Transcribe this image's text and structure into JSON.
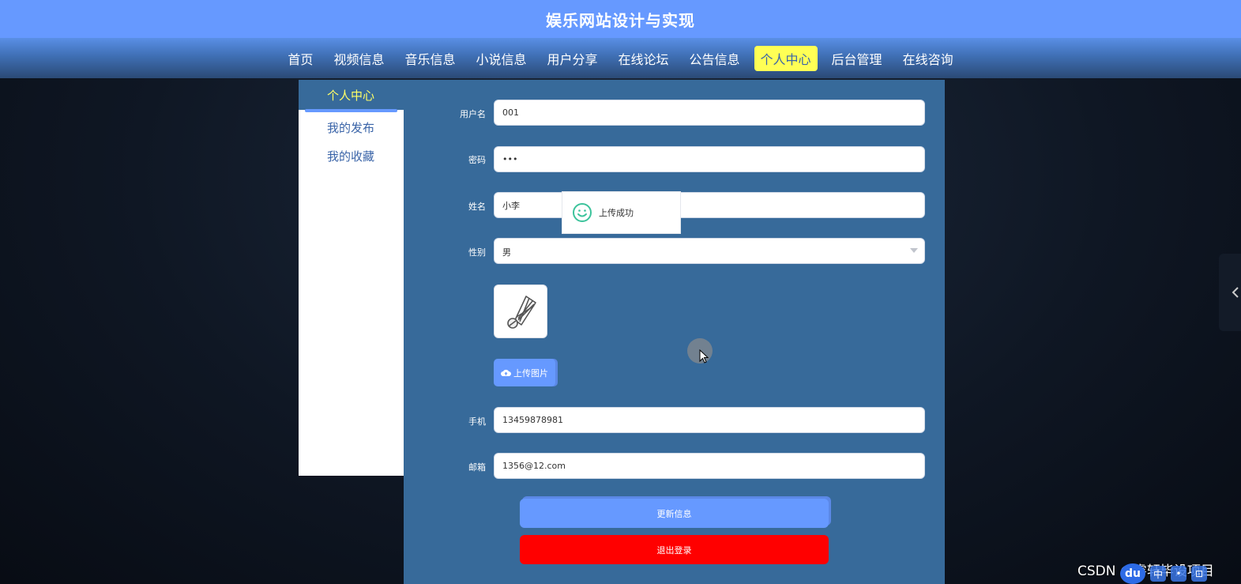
{
  "site_title": "娱乐网站设计与实现",
  "nav": {
    "items": [
      "首页",
      "视频信息",
      "音乐信息",
      "小说信息",
      "用户分享",
      "在线论坛",
      "公告信息",
      "个人中心",
      "后台管理",
      "在线咨询"
    ],
    "active": "个人中心"
  },
  "sidebar": {
    "title": "个人中心",
    "items": [
      "我的发布",
      "我的收藏"
    ]
  },
  "form": {
    "username": {
      "label": "用户名",
      "value": "001"
    },
    "password": {
      "label": "密码",
      "value": "•••"
    },
    "name": {
      "label": "姓名",
      "value": "小李"
    },
    "gender": {
      "label": "性别",
      "value": "男"
    },
    "upload_label": "上传图片",
    "phone": {
      "label": "手机",
      "value": "13459878981"
    },
    "email": {
      "label": "邮箱",
      "value": "1356@12.com"
    },
    "update_label": "更新信息",
    "logout_label": "退出登录"
  },
  "toast": {
    "message": "上传成功",
    "icon": "smile-icon"
  },
  "watermark": "CSDN @睿轩毕设项目",
  "ime": {
    "logo": "du",
    "keys": [
      "中",
      "•",
      "⊡"
    ]
  },
  "colors": {
    "primary": "#6699ff",
    "panel": "#376a9a",
    "active_nav": "#ffff55",
    "danger": "#ff0000",
    "toast_icon": "#3cc39b"
  }
}
